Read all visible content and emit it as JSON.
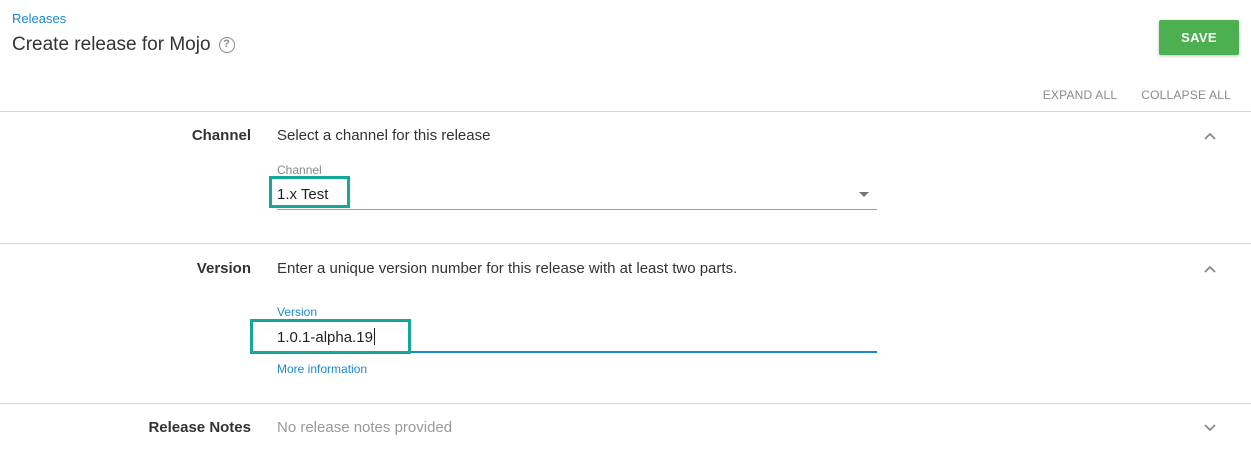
{
  "header": {
    "breadcrumb": "Releases",
    "title": "Create release for Mojo",
    "help_icon": "question-circle-icon",
    "save_label": "SAVE",
    "expand_all": "EXPAND ALL",
    "collapse_all": "COLLAPSE ALL"
  },
  "sections": {
    "channel": {
      "label": "Channel",
      "summary": "Select a channel for this release",
      "field_label": "Channel",
      "value": "1.x Test",
      "chevron": "chevron-up-icon"
    },
    "version": {
      "label": "Version",
      "summary": "Enter a unique version number for this release with at least two parts.",
      "field_label": "Version",
      "value": "1.0.1-alpha.19",
      "more_info": "More information",
      "chevron": "chevron-up-icon"
    },
    "release_notes": {
      "label": "Release Notes",
      "summary": "No release notes provided",
      "chevron": "chevron-down-icon"
    }
  },
  "colors": {
    "accent": "#1a88d6",
    "save": "#4caf50",
    "highlight": "#15a89a"
  }
}
